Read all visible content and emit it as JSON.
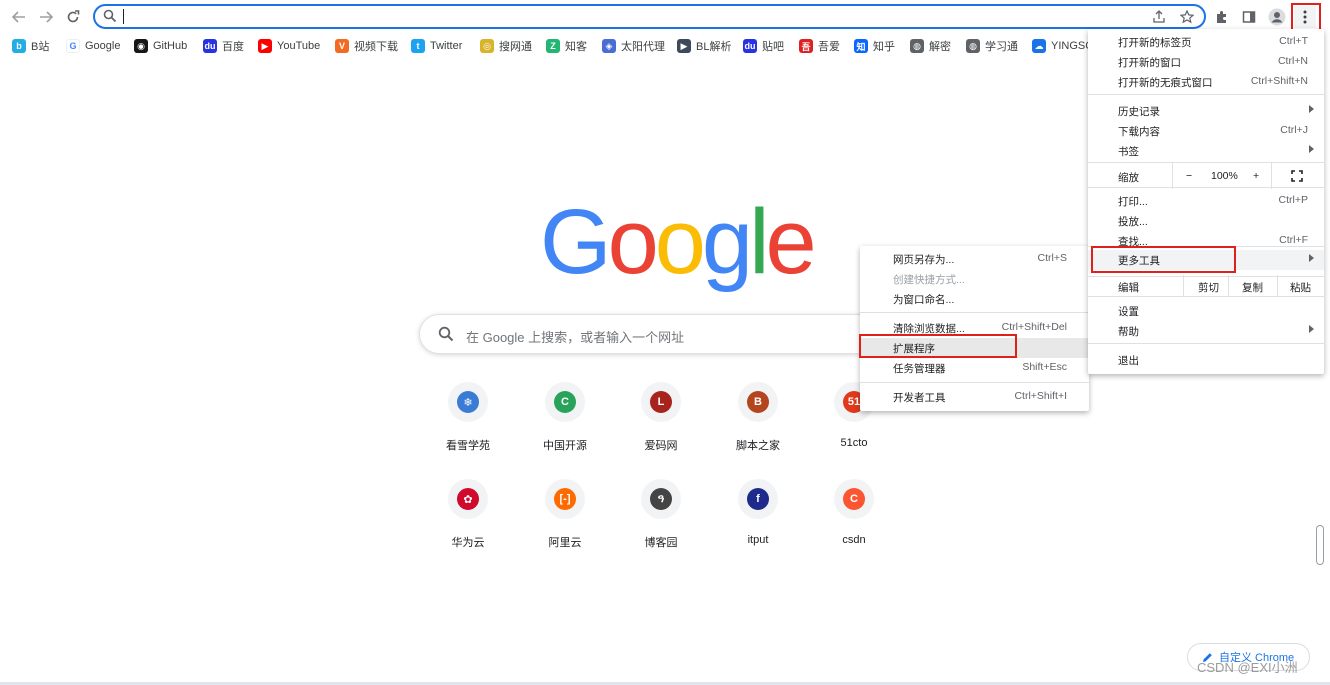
{
  "toolbar": {
    "back_icon": "arrow-left-icon",
    "forward_icon": "arrow-right-icon",
    "reload_icon": "reload-icon",
    "omnibox_value": "",
    "share_icon": "share-icon",
    "star_icon": "star-icon",
    "extensions_icon": "puzzle-icon",
    "sidepanel_icon": "side-panel-icon",
    "profile_icon": "profile-icon",
    "menu_icon": "kebab-menu-icon"
  },
  "bookmarks": [
    {
      "label": "B站",
      "color": "#23ade5",
      "glyph": "b"
    },
    {
      "label": "Google",
      "color": "#ffffff",
      "glyph": "G"
    },
    {
      "label": "GitHub",
      "color": "#181717",
      "glyph": "◉"
    },
    {
      "label": "百度",
      "color": "#2932e1",
      "glyph": "du"
    },
    {
      "label": "YouTube",
      "color": "#ff0000",
      "glyph": "▶"
    },
    {
      "label": "视频下载",
      "color": "#f36b21",
      "glyph": "V"
    },
    {
      "label": "Twitter",
      "color": "#1da1f2",
      "glyph": "t"
    },
    {
      "label": "搜网通",
      "color": "#d8b42b",
      "glyph": "◎"
    },
    {
      "label": "知客",
      "color": "#22b573",
      "glyph": "Z"
    },
    {
      "label": "太阳代理",
      "color": "#4b6bd6",
      "glyph": "◈"
    },
    {
      "label": "BL解析",
      "color": "#3e4a5b",
      "glyph": "▶"
    },
    {
      "label": "贴吧",
      "color": "#2932e1",
      "glyph": "du"
    },
    {
      "label": "吾爱",
      "color": "#e02020",
      "glyph": "吾"
    },
    {
      "label": "知乎",
      "color": "#0a66ff",
      "glyph": "知"
    },
    {
      "label": "解密",
      "color": "#5f6368",
      "glyph": "◍"
    },
    {
      "label": "学习通",
      "color": "#5f6368",
      "glyph": "◍"
    },
    {
      "label": "YINGSC",
      "color": "#1a73e8",
      "glyph": "☁"
    }
  ],
  "google_logo": [
    "G",
    "o",
    "o",
    "g",
    "l",
    "e"
  ],
  "logo_colors": [
    "#4285f4",
    "#ea4335",
    "#fbbc05",
    "#4285f4",
    "#34a853",
    "#ea4335"
  ],
  "search": {
    "placeholder": "在 Google 上搜索，或者输入一个网址"
  },
  "shortcuts": [
    {
      "label": "看雪学苑",
      "color": "#3a7bd5",
      "glyph": "❄"
    },
    {
      "label": "中国开源",
      "color": "#2aa35a",
      "glyph": "C"
    },
    {
      "label": "爱码网",
      "color": "#a8231c",
      "glyph": "L"
    },
    {
      "label": "脚本之家",
      "color": "#b3461e",
      "glyph": "B"
    },
    {
      "label": "51cto",
      "color": "#e0391c",
      "glyph": "51"
    },
    {
      "label": "华为云",
      "color": "#cf0a2c",
      "glyph": "✿"
    },
    {
      "label": "阿里云",
      "color": "#ff6a00",
      "glyph": "[-]"
    },
    {
      "label": "博客园",
      "color": "#444444",
      "glyph": "ዓ"
    },
    {
      "label": "itput",
      "color": "#1f2b8c",
      "glyph": "f"
    },
    {
      "label": "csdn",
      "color": "#fc5531",
      "glyph": "C"
    }
  ],
  "menu": {
    "items": [
      {
        "label": "打开新的标签页",
        "shortcut": "Ctrl+T"
      },
      {
        "label": "打开新的窗口",
        "shortcut": "Ctrl+N"
      },
      {
        "label": "打开新的无痕式窗口",
        "shortcut": "Ctrl+Shift+N"
      },
      {
        "label": "历史记录",
        "shortcut": ""
      },
      {
        "label": "下载内容",
        "shortcut": "Ctrl+J"
      },
      {
        "label": "书签",
        "shortcut": ""
      },
      {
        "label": "打印...",
        "shortcut": "Ctrl+P"
      },
      {
        "label": "投放...",
        "shortcut": ""
      },
      {
        "label": "查找...",
        "shortcut": "Ctrl+F"
      },
      {
        "label": "更多工具",
        "shortcut": ""
      },
      {
        "label": "设置",
        "shortcut": ""
      },
      {
        "label": "帮助",
        "shortcut": ""
      },
      {
        "label": "退出",
        "shortcut": ""
      }
    ],
    "zoom": {
      "label": "缩放",
      "minus": "−",
      "value": "100%",
      "plus": "+"
    },
    "edit": {
      "label": "编辑",
      "cut": "剪切",
      "copy": "复制",
      "paste": "粘贴"
    }
  },
  "submenu": {
    "items": [
      {
        "label": "网页另存为...",
        "shortcut": "Ctrl+S"
      },
      {
        "label": "创建快捷方式...",
        "shortcut": ""
      },
      {
        "label": "为窗口命名...",
        "shortcut": ""
      },
      {
        "label": "清除浏览数据...",
        "shortcut": "Ctrl+Shift+Del"
      },
      {
        "label": "扩展程序",
        "shortcut": ""
      },
      {
        "label": "任务管理器",
        "shortcut": "Shift+Esc"
      },
      {
        "label": "开发者工具",
        "shortcut": "Ctrl+Shift+I"
      }
    ]
  },
  "customize": {
    "label": "自定义 Chrome"
  },
  "watermark": "CSDN @EXI小洲"
}
